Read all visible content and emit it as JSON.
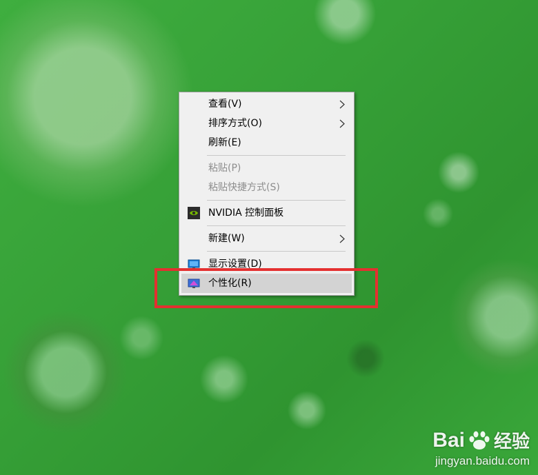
{
  "context_menu": {
    "items": [
      {
        "label": "查看(V)",
        "submenu": true,
        "disabled": false
      },
      {
        "label": "排序方式(O)",
        "submenu": true,
        "disabled": false
      },
      {
        "label": "刷新(E)",
        "submenu": false,
        "disabled": false
      },
      {
        "label": "粘贴(P)",
        "submenu": false,
        "disabled": true
      },
      {
        "label": "粘贴快捷方式(S)",
        "submenu": false,
        "disabled": true
      },
      {
        "label": "NVIDIA 控制面板",
        "icon": "nvidia-icon"
      },
      {
        "label": "新建(W)",
        "submenu": true,
        "disabled": false
      },
      {
        "label": "显示设置(D)",
        "icon": "display-settings-icon"
      },
      {
        "label": "个性化(R)",
        "icon": "personalize-icon",
        "highlighted": true
      }
    ]
  },
  "annotation": {
    "color": "#e43030",
    "target": "个性化(R)"
  },
  "watermark": {
    "brand_left": "Bai",
    "brand_right": "经验",
    "url": "jingyan.baidu.com"
  },
  "colors": {
    "menu_bg": "#f0f0f0",
    "highlight_bg": "#d3d3d3",
    "disabled_text": "#8d8d8d",
    "nvidia_green": "#76b900"
  }
}
